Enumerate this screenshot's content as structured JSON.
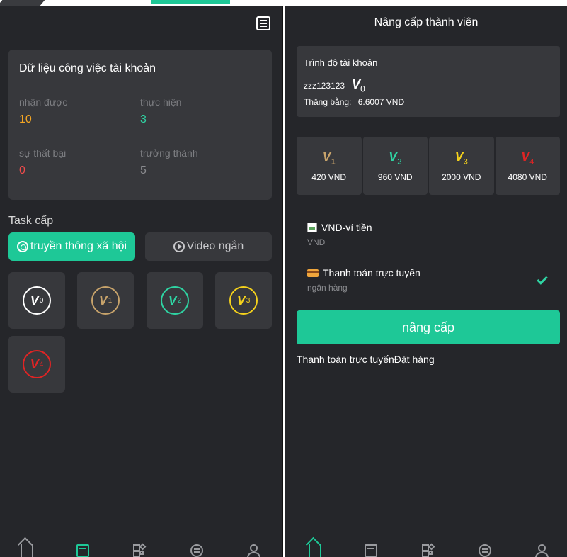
{
  "left": {
    "stats": {
      "title": "Dữ liệu công việc tài khoản",
      "received_label": "nhận được",
      "received_value": "10",
      "done_label": "thực hiện",
      "done_value": "3",
      "fail_label": "sự thất bại",
      "fail_value": "0",
      "mature_label": "trưởng thành",
      "mature_value": "5"
    },
    "task_title": "Task cấp",
    "tabs": {
      "social": "truyền thông xã hội",
      "video": "Video ngắn"
    },
    "levels": [
      {
        "letter": "V",
        "num": "0",
        "color": "#ffffff"
      },
      {
        "letter": "V",
        "num": "1",
        "color": "#c7a36b"
      },
      {
        "letter": "V",
        "num": "2",
        "color": "#2fd4a3"
      },
      {
        "letter": "V",
        "num": "3",
        "color": "#f5d21c"
      },
      {
        "letter": "V",
        "num": "4",
        "color": "#e02424"
      }
    ]
  },
  "right": {
    "title": "Nâng cấp thành viên",
    "account": {
      "level_label": "Trình độ tài khoản",
      "username": "zzz123123",
      "level_letter": "V",
      "level_num": "0",
      "balance_label": "Thăng bằng:",
      "balance_value": "6.6007 VND"
    },
    "tiers": [
      {
        "letter": "V",
        "num": "1",
        "price": "420 VND",
        "color": "#c7a36b"
      },
      {
        "letter": "V",
        "num": "2",
        "price": "960 VND",
        "color": "#2fd4a3"
      },
      {
        "letter": "V",
        "num": "3",
        "price": "2000 VND",
        "color": "#f5d21c"
      },
      {
        "letter": "V",
        "num": "4",
        "price": "4080 VND",
        "color": "#e02424"
      }
    ],
    "payments": [
      {
        "name": "VND-ví tiền",
        "sub": "VND"
      },
      {
        "name": "Thanh toán trực tuyến",
        "sub": "ngân hàng"
      }
    ],
    "upgrade_button": "nâng cấp",
    "order_link": "Thanh toán trực tuyếnĐặt hàng"
  },
  "colors": {
    "accent": "#1ec897",
    "panel": "#25262a",
    "card": "#37383c"
  },
  "icons": [
    "list-icon",
    "home-icon",
    "task-icon",
    "grid-icon",
    "exchange-icon",
    "user-icon",
    "check-icon",
    "card-icon"
  ]
}
